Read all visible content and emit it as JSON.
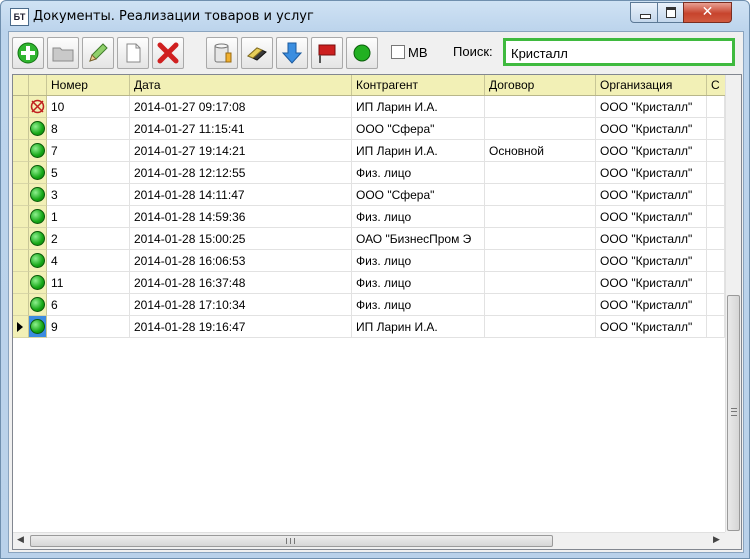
{
  "window": {
    "app_icon": "БТ",
    "title": "Документы. Реализации товаров и услуг",
    "close_glyph": "✕"
  },
  "toolbar": {
    "buttons": [
      {
        "name": "add-button",
        "icon": "plus-circle-icon"
      },
      {
        "name": "open-button",
        "icon": "folder-icon"
      },
      {
        "name": "edit-button",
        "icon": "pencil-icon"
      },
      {
        "name": "copy-button",
        "icon": "document-icon"
      },
      {
        "name": "delete-button",
        "icon": "red-x-icon"
      },
      {
        "name": "database-button",
        "icon": "database-icon"
      },
      {
        "name": "eraser-button",
        "icon": "eraser-icon"
      },
      {
        "name": "download-button",
        "icon": "arrow-down-icon"
      },
      {
        "name": "flag-button",
        "icon": "red-flag-icon"
      },
      {
        "name": "status-button",
        "icon": "green-circle-icon"
      }
    ],
    "mb_label": "МВ",
    "mb_checked": false,
    "search_label": "Поиск:",
    "search_value": "Кристалл"
  },
  "table": {
    "columns": [
      "Номер",
      "Дата",
      "Контрагент",
      "Договор",
      "Организация",
      "С"
    ],
    "rows": [
      {
        "status": "deleted",
        "number": "10",
        "date": "2014-01-27 09:17:08",
        "counterparty": "ИП Ларин И.А.",
        "contract": "",
        "org": "ООО \"Кристалл\""
      },
      {
        "status": "posted",
        "number": "8",
        "date": "2014-01-27 11:15:41",
        "counterparty": "ООО \"Сфера\"",
        "contract": "",
        "org": "ООО \"Кристалл\""
      },
      {
        "status": "posted",
        "number": "7",
        "date": "2014-01-27 19:14:21",
        "counterparty": "ИП Ларин И.А.",
        "contract": "Основной",
        "org": "ООО \"Кристалл\""
      },
      {
        "status": "posted",
        "number": "5",
        "date": "2014-01-28 12:12:55",
        "counterparty": "Физ. лицо",
        "contract": "",
        "org": "ООО \"Кристалл\""
      },
      {
        "status": "posted",
        "number": "3",
        "date": "2014-01-28 14:11:47",
        "counterparty": "ООО \"Сфера\"",
        "contract": "",
        "org": "ООО \"Кристалл\""
      },
      {
        "status": "posted",
        "number": "1",
        "date": "2014-01-28 14:59:36",
        "counterparty": "Физ. лицо",
        "contract": "",
        "org": "ООО \"Кристалл\""
      },
      {
        "status": "posted",
        "number": "2",
        "date": "2014-01-28 15:00:25",
        "counterparty": "ОАО \"БизнесПром Э",
        "contract": "",
        "org": "ООО \"Кристалл\""
      },
      {
        "status": "posted",
        "number": "4",
        "date": "2014-01-28 16:06:53",
        "counterparty": "Физ. лицо",
        "contract": "",
        "org": "ООО \"Кристалл\""
      },
      {
        "status": "posted",
        "number": "11",
        "date": "2014-01-28 16:37:48",
        "counterparty": "Физ. лицо",
        "contract": "",
        "org": "ООО \"Кристалл\""
      },
      {
        "status": "posted",
        "number": "6",
        "date": "2014-01-28 17:10:34",
        "counterparty": "Физ. лицо",
        "contract": "",
        "org": "ООО \"Кристалл\""
      },
      {
        "status": "posted",
        "current": true,
        "number": "9",
        "date": "2014-01-28 19:16:47",
        "counterparty": "ИП Ларин И.А.",
        "contract": "",
        "org": "ООО \"Кристалл\""
      }
    ]
  },
  "scroll": {
    "left_arrow": "◀",
    "right_arrow": "▶",
    "vertical_position": 1.0,
    "horizontal_position": 0.0
  },
  "colors": {
    "header_bg": "#f2f0b6",
    "search_border": "#3fba3f",
    "status_green": "#16a716",
    "selected_cell": "#3c8be0"
  }
}
